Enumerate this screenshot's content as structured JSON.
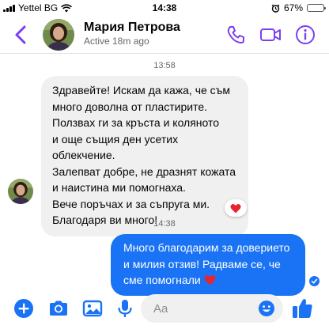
{
  "status_bar": {
    "carrier": "Yettel BG",
    "time": "14:38",
    "battery": "67%",
    "battery_level": 0.67
  },
  "header": {
    "contact_name": "Мария Петрова",
    "status": "Active 18m ago",
    "icons": [
      "back-chevron-icon",
      "phone-icon",
      "video-camera-icon",
      "info-icon"
    ]
  },
  "chat": {
    "timestamp_1": "13:58",
    "incoming_message": {
      "lines": [
        "Здравейте! Искам да кажа, че съм",
        "много доволна от пластирите.",
        "Ползвах ги за кръста и коляното",
        "и още същия ден усетих облекчение.",
        "Залепват добре, не дразнят кожата",
        "и наистина ми помогнаха.",
        "Вече поръчах и за съпруга ми.",
        "Благодаря ви много!"
      ],
      "reaction": "heart-icon"
    },
    "timestamp_2": "14:38",
    "outgoing_message": {
      "lines": [
        "Много благодарим за доверието",
        "и милия отзив! Радваме се, че",
        "сме помогнали"
      ],
      "emoji": "heart-icon",
      "read_receipt": "seen-check-icon"
    }
  },
  "composer": {
    "placeholder": "Aa",
    "icons": [
      "plus-icon",
      "camera-icon",
      "gallery-icon",
      "microphone-icon",
      "emoji-icon",
      "thumbs-up-icon"
    ]
  },
  "colors": {
    "accent": "#7b3ff2",
    "outgoing_bubble": "#1a73f5",
    "incoming_bubble": "#f0f0f0",
    "heart": "#e8242f"
  }
}
